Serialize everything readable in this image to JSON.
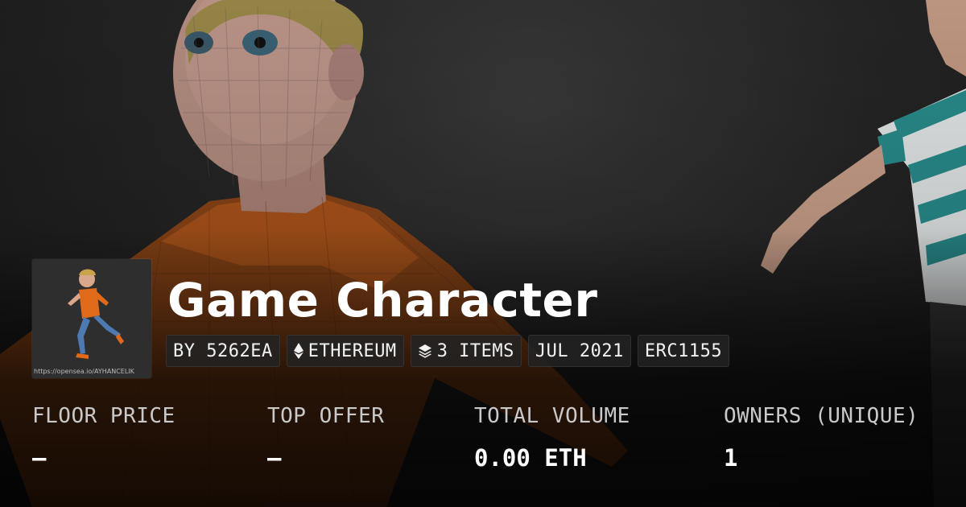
{
  "collection": {
    "title": "Game Character",
    "thumbnail_caption": "https://opensea.io/AYHANCELIK",
    "tags": [
      {
        "icon": "none",
        "label": "BY 5262EA"
      },
      {
        "icon": "ethereum-icon",
        "label": "ETHEREUM"
      },
      {
        "icon": "layers-icon",
        "label": "3 ITEMS"
      },
      {
        "icon": "none",
        "label": "JUL 2021"
      },
      {
        "icon": "none",
        "label": "ERC1155"
      }
    ]
  },
  "stats": [
    {
      "label": "FLOOR PRICE",
      "value": "–"
    },
    {
      "label": "TOP OFFER",
      "value": "–"
    },
    {
      "label": "TOTAL VOLUME",
      "value": "0.00 ETH"
    },
    {
      "label": "OWNERS (UNIQUE)",
      "value": "1"
    }
  ],
  "colors": {
    "background": "#1d1d1d",
    "text": "#ffffff",
    "label_text": "#c9c9c9",
    "tag_background": "#232323",
    "shirt_orange": "#e06a1a",
    "shirt_stripe_teal": "#2a8f8f"
  }
}
